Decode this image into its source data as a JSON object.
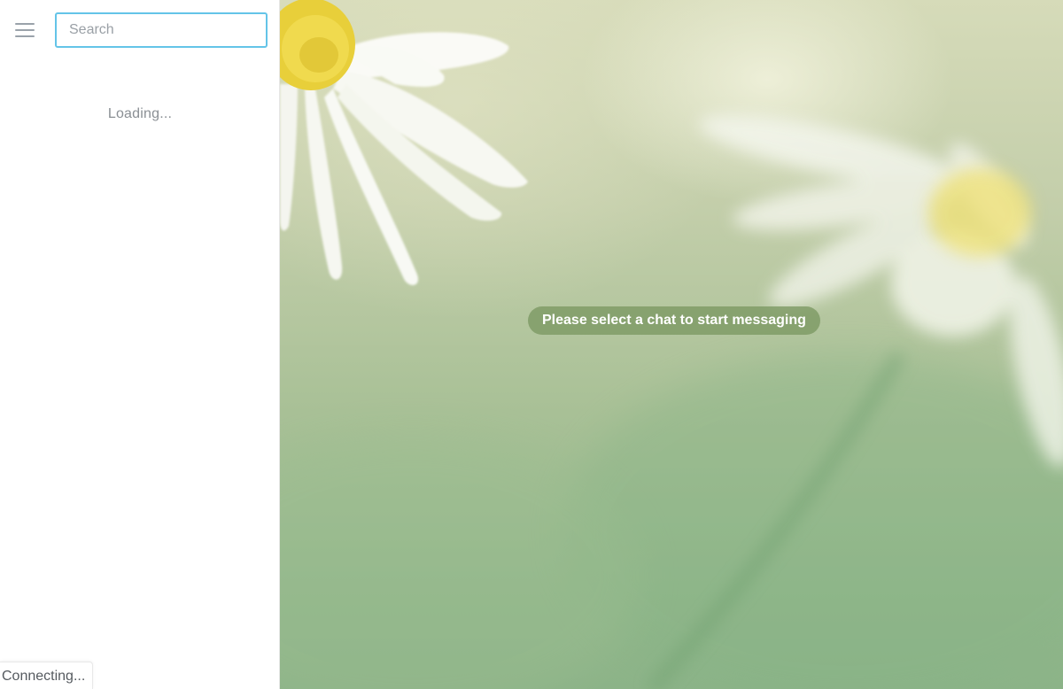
{
  "sidebar": {
    "menu_icon": "hamburger-menu-icon",
    "search": {
      "placeholder": "Search",
      "value": ""
    },
    "loading_text": "Loading...",
    "connection_status": "Connecting..."
  },
  "main": {
    "empty_state_message": "Please select a chat to start messaging",
    "wallpaper": "daisy-flowers-wallpaper"
  },
  "colors": {
    "search_border": "#64c4e8",
    "pill_background": "#78965f",
    "wallpaper_base": "#a8c096"
  }
}
